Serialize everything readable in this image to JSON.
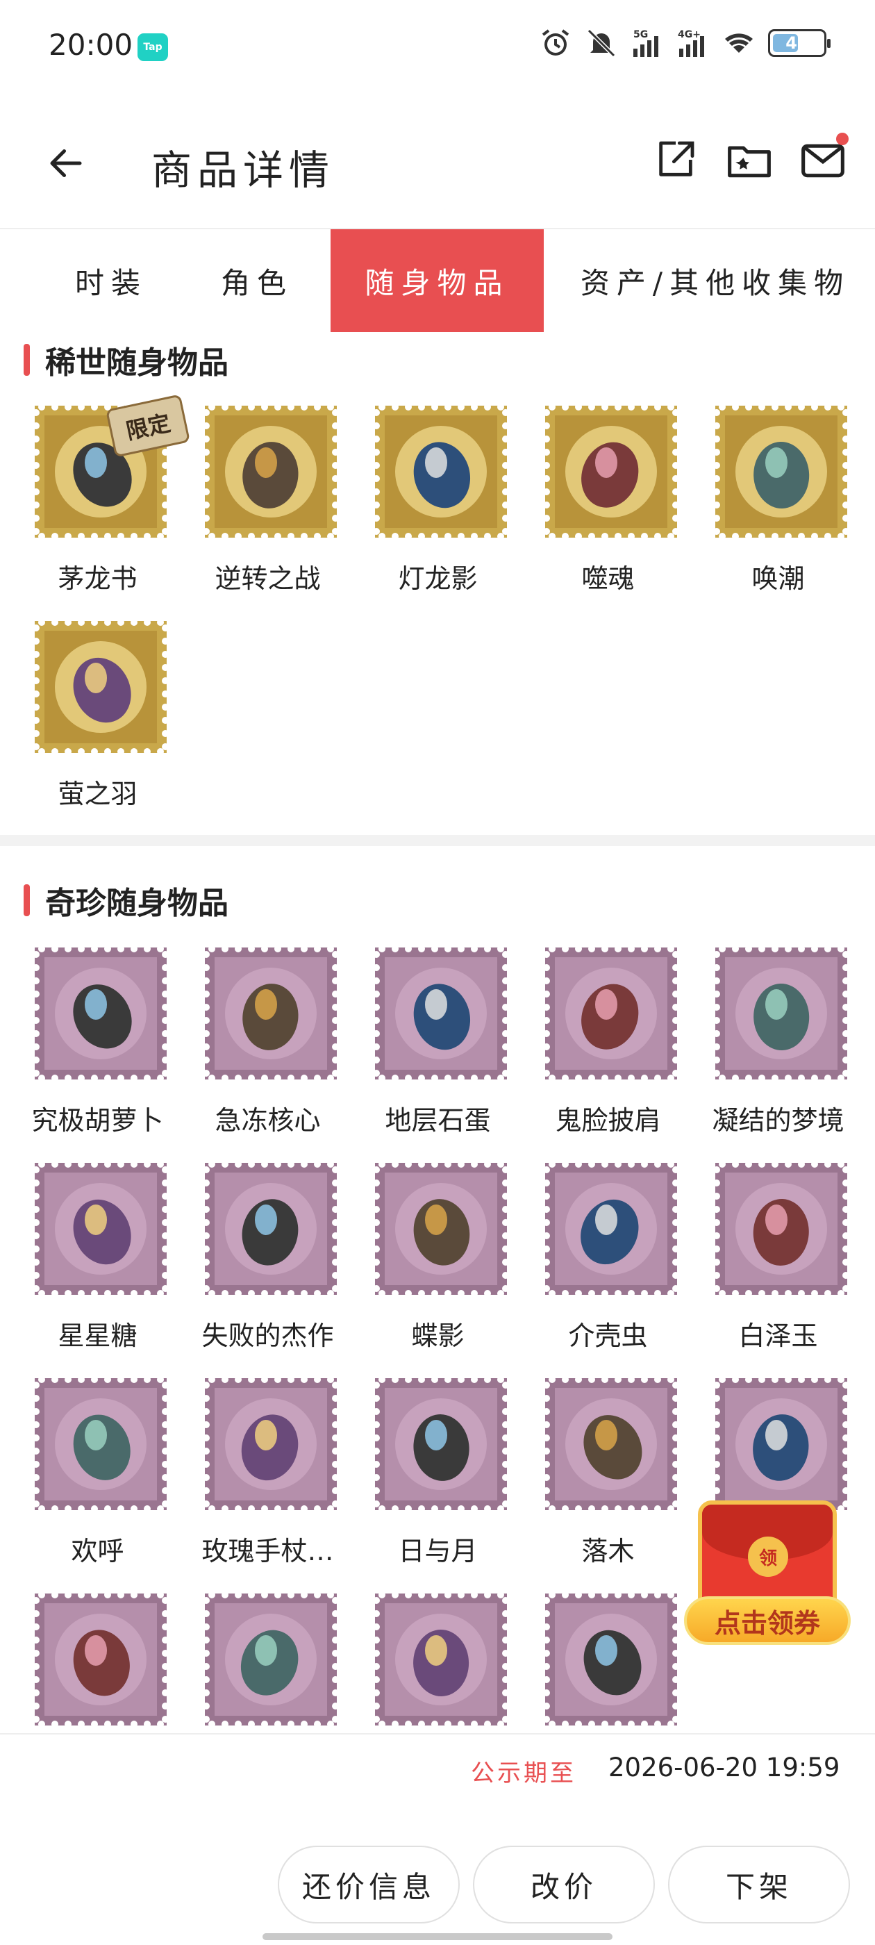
{
  "status_bar": {
    "time": "20:00",
    "tap_badge": "Tap",
    "battery": "40",
    "net1": "5G",
    "net2": "4G+"
  },
  "header": {
    "title": "商品详情"
  },
  "tabs": [
    {
      "label": "时装",
      "active": false
    },
    {
      "label": "角色",
      "active": false
    },
    {
      "label": "随身物品",
      "active": true
    },
    {
      "label": "资产/其他收集物",
      "active": false
    }
  ],
  "rare_section": {
    "title": "稀世随身物品",
    "limited_badge": "限定",
    "items": [
      {
        "name": "茅龙书",
        "icon": "book-dragon-icon"
      },
      {
        "name": "逆转之战",
        "icon": "winged-helmet-icon"
      },
      {
        "name": "灯龙影",
        "icon": "lantern-icon"
      },
      {
        "name": "噬魂",
        "icon": "scythe-icon"
      },
      {
        "name": "唤潮",
        "icon": "wave-icon"
      },
      {
        "name": "萤之羽",
        "icon": "butterfly-icon"
      }
    ]
  },
  "treasure_section": {
    "title": "奇珍随身物品",
    "items": [
      {
        "name": "究极胡萝卜",
        "icon": "carrot-jar-icon"
      },
      {
        "name": "急冻核心",
        "icon": "frozen-core-icon"
      },
      {
        "name": "地层石蛋",
        "icon": "stone-egg-icon"
      },
      {
        "name": "鬼脸披肩",
        "icon": "shawl-icon"
      },
      {
        "name": "凝结的梦境",
        "icon": "dream-crystal-icon"
      },
      {
        "name": "星星糖",
        "icon": "candy-jar-icon"
      },
      {
        "name": "失败的杰作",
        "icon": "doll-icon"
      },
      {
        "name": "蝶影",
        "icon": "white-butterfly-icon"
      },
      {
        "name": "介壳虫",
        "icon": "beetle-icon"
      },
      {
        "name": "白泽玉",
        "icon": "jade-deer-icon"
      },
      {
        "name": "欢呼",
        "icon": "feather-duster-icon"
      },
      {
        "name": "玫瑰手杖…",
        "icon": "rose-cane-icon"
      },
      {
        "name": "日与月",
        "icon": "sun-key-icon"
      },
      {
        "name": "落木",
        "icon": "leaf-frame-icon"
      },
      {
        "name": "",
        "icon": "compass-icon"
      },
      {
        "name": "",
        "icon": "clockwork-icon"
      },
      {
        "name": "",
        "icon": "crown-icon"
      },
      {
        "name": "",
        "icon": "blue-gem-icon"
      },
      {
        "name": "",
        "icon": "thorn-wreath-icon"
      }
    ]
  },
  "coupon": {
    "seal": "领",
    "label": "点击领券"
  },
  "footer": {
    "publicity_label": "公示期至",
    "publicity_date": "2026-06-20 19:59",
    "buttons": [
      "还价信息",
      "改价",
      "下架"
    ]
  },
  "colors": {
    "accent": "#e84f51",
    "gold_stamp": "#c9a84a",
    "purple_stamp": "#9a7590"
  }
}
